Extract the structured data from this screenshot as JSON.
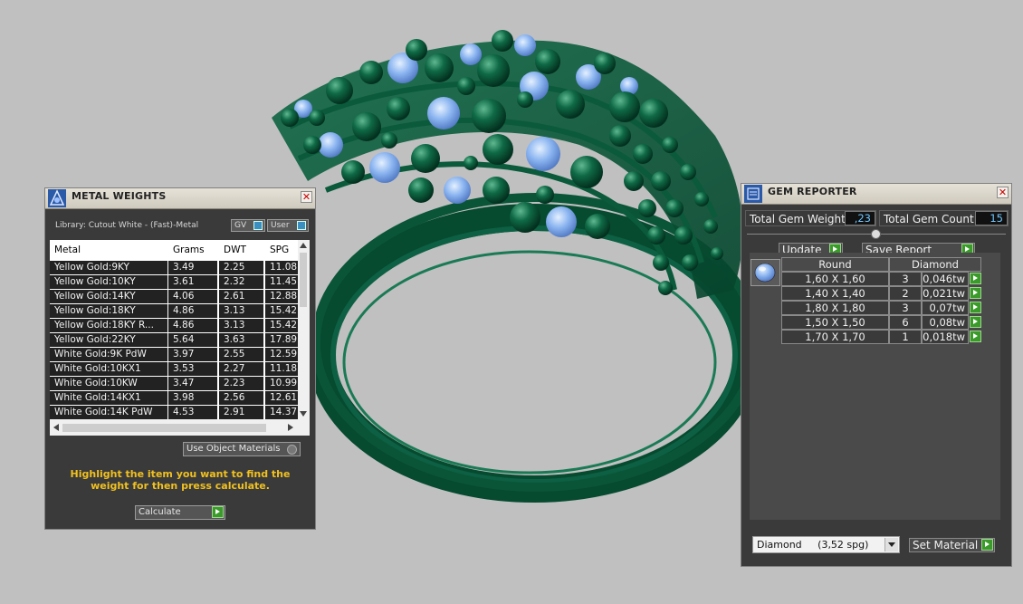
{
  "metal_weights": {
    "title": "METAL WEIGHTS",
    "close_label": "✕",
    "library_label": "Library: Cutout White - (Fast)-Metal",
    "gv_label": "GV",
    "user_label": "User",
    "columns": [
      "Metal",
      "Grams",
      "DWT",
      "SPG"
    ],
    "rows": [
      [
        "Yellow Gold:9KY",
        "3.49",
        "2.25",
        "11.08"
      ],
      [
        "Yellow Gold:10KY",
        "3.61",
        "2.32",
        "11.45"
      ],
      [
        "Yellow Gold:14KY",
        "4.06",
        "2.61",
        "12.88"
      ],
      [
        "Yellow Gold:18KY",
        "4.86",
        "3.13",
        "15.42"
      ],
      [
        "Yellow Gold:18KY R...",
        "4.86",
        "3.13",
        "15.42"
      ],
      [
        "Yellow Gold:22KY",
        "5.64",
        "3.63",
        "17.89"
      ],
      [
        "White Gold:9K PdW",
        "3.97",
        "2.55",
        "12.59"
      ],
      [
        "White Gold:10KX1",
        "3.53",
        "2.27",
        "11.18"
      ],
      [
        "White Gold:10KW",
        "3.47",
        "2.23",
        "10.99"
      ],
      [
        "White Gold:14KX1",
        "3.98",
        "2.56",
        "12.61"
      ],
      [
        "White Gold:14K PdW",
        "4.53",
        "2.91",
        "14.37"
      ]
    ],
    "use_object_materials_label": "Use Object Materials",
    "instruction": "Highlight the item you want to find the weight for then press calculate.",
    "calculate_label": "Calculate"
  },
  "gem_reporter": {
    "title": "GEM REPORTER",
    "close_label": "✕",
    "total_gem_weight_label": "Total Gem Weight",
    "total_gem_weight_value": ",23",
    "total_gem_count_label": "Total Gem Count",
    "total_gem_count_value": "15",
    "update_label": "Update",
    "save_report_label": "Save Report",
    "headers": [
      "Round",
      "Diamond"
    ],
    "rows": [
      [
        "1,60 X 1,60",
        "3",
        "0,046tw"
      ],
      [
        "1,40 X 1,40",
        "2",
        "0,021tw"
      ],
      [
        "1,80 X 1,80",
        "3",
        "0,07tw"
      ],
      [
        "1,50 X 1,50",
        "6",
        "0,08tw"
      ],
      [
        "1,70 X 1,70",
        "1",
        "0,018tw"
      ]
    ],
    "material_select": "Diamond     (3,52 spg)",
    "set_material_label": "Set Material"
  },
  "colors": {
    "background": "#c0c0c0",
    "ring_green": "#0c5a3c",
    "gem_blue": "#8ab4f0",
    "instruction_yellow": "#f0c020"
  }
}
